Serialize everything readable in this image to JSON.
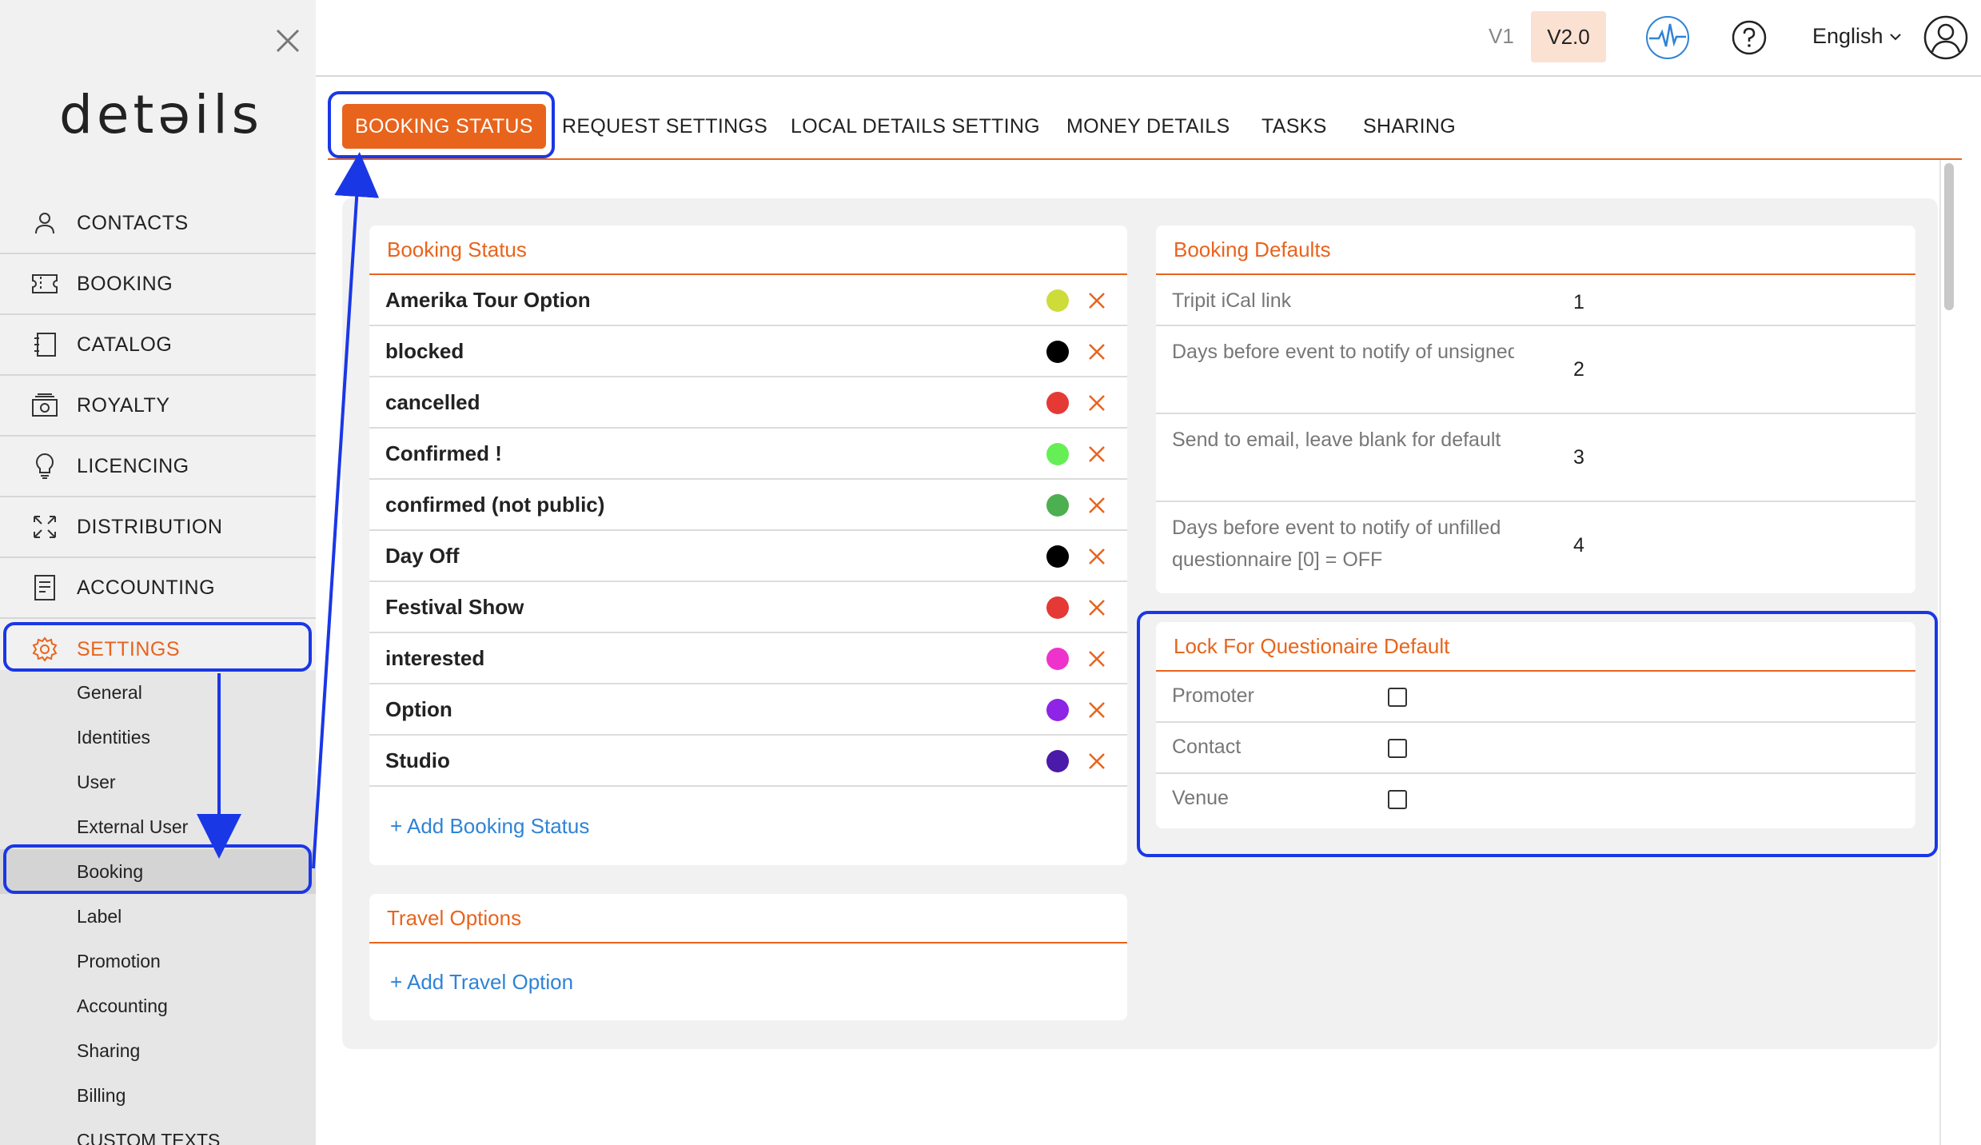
{
  "sidebar": {
    "logo": "detəils",
    "nav": [
      {
        "label": "CONTACTS",
        "icon": "person-icon"
      },
      {
        "label": "BOOKING",
        "icon": "ticket-icon"
      },
      {
        "label": "CATALOG",
        "icon": "catalog-icon"
      },
      {
        "label": "ROYALTY",
        "icon": "money-icon"
      },
      {
        "label": "LICENCING",
        "icon": "bulb-icon"
      },
      {
        "label": "DISTRIBUTION",
        "icon": "expand-arrows-icon"
      },
      {
        "label": "ACCOUNTING",
        "icon": "document-icon"
      },
      {
        "label": "SETTINGS",
        "icon": "gear-icon"
      }
    ],
    "settings_sub": [
      "General",
      "Identities",
      "User",
      "External User",
      "Booking",
      "Label",
      "Promotion",
      "Accounting",
      "Sharing",
      "Billing",
      "CUSTOM TEXTS"
    ]
  },
  "topbar": {
    "v1": "V1",
    "v2": "V2.0",
    "language": "English"
  },
  "tabs": [
    "BOOKING STATUS",
    "REQUEST SETTINGS",
    "LOCAL DETAILS SETTING",
    "MONEY DETAILS",
    "TASKS",
    "SHARING"
  ],
  "booking_status": {
    "title": "Booking Status",
    "items": [
      {
        "name": "Amerika Tour Option",
        "color": "#cddc39"
      },
      {
        "name": "blocked",
        "color": "#000000"
      },
      {
        "name": "cancelled",
        "color": "#e53935"
      },
      {
        "name": "Confirmed !",
        "color": "#66ee55"
      },
      {
        "name": "confirmed (not public)",
        "color": "#4caf50"
      },
      {
        "name": "Day Off",
        "color": "#000000"
      },
      {
        "name": "Festival Show",
        "color": "#e53935"
      },
      {
        "name": "interested",
        "color": "#ee33cc"
      },
      {
        "name": "Option",
        "color": "#8e24e6"
      },
      {
        "name": "Studio",
        "color": "#4a1aa8"
      }
    ],
    "add_label": "+ Add Booking Status"
  },
  "travel_options": {
    "title": "Travel Options",
    "add_label": "+ Add Travel Option"
  },
  "booking_defaults": {
    "title": "Booking Defaults",
    "rows": [
      {
        "label": "Tripit iCal link",
        "value": "1"
      },
      {
        "label": "Days before event to notify of unsigned",
        "value": "2"
      },
      {
        "label": "Send to email, leave blank for default",
        "value": "3"
      },
      {
        "label": "Days before event to notify of unfilled questionnaire [0] = OFF",
        "value": "4"
      }
    ]
  },
  "lock_questionnaire": {
    "title": "Lock For Questionaire Default",
    "rows": [
      {
        "label": "Promoter",
        "checked": false
      },
      {
        "label": "Contact",
        "checked": false
      },
      {
        "label": "Venue",
        "checked": false
      }
    ]
  },
  "colors": {
    "accent": "#e8641c",
    "link": "#2f83d6",
    "annotation": "#1a37e6"
  }
}
